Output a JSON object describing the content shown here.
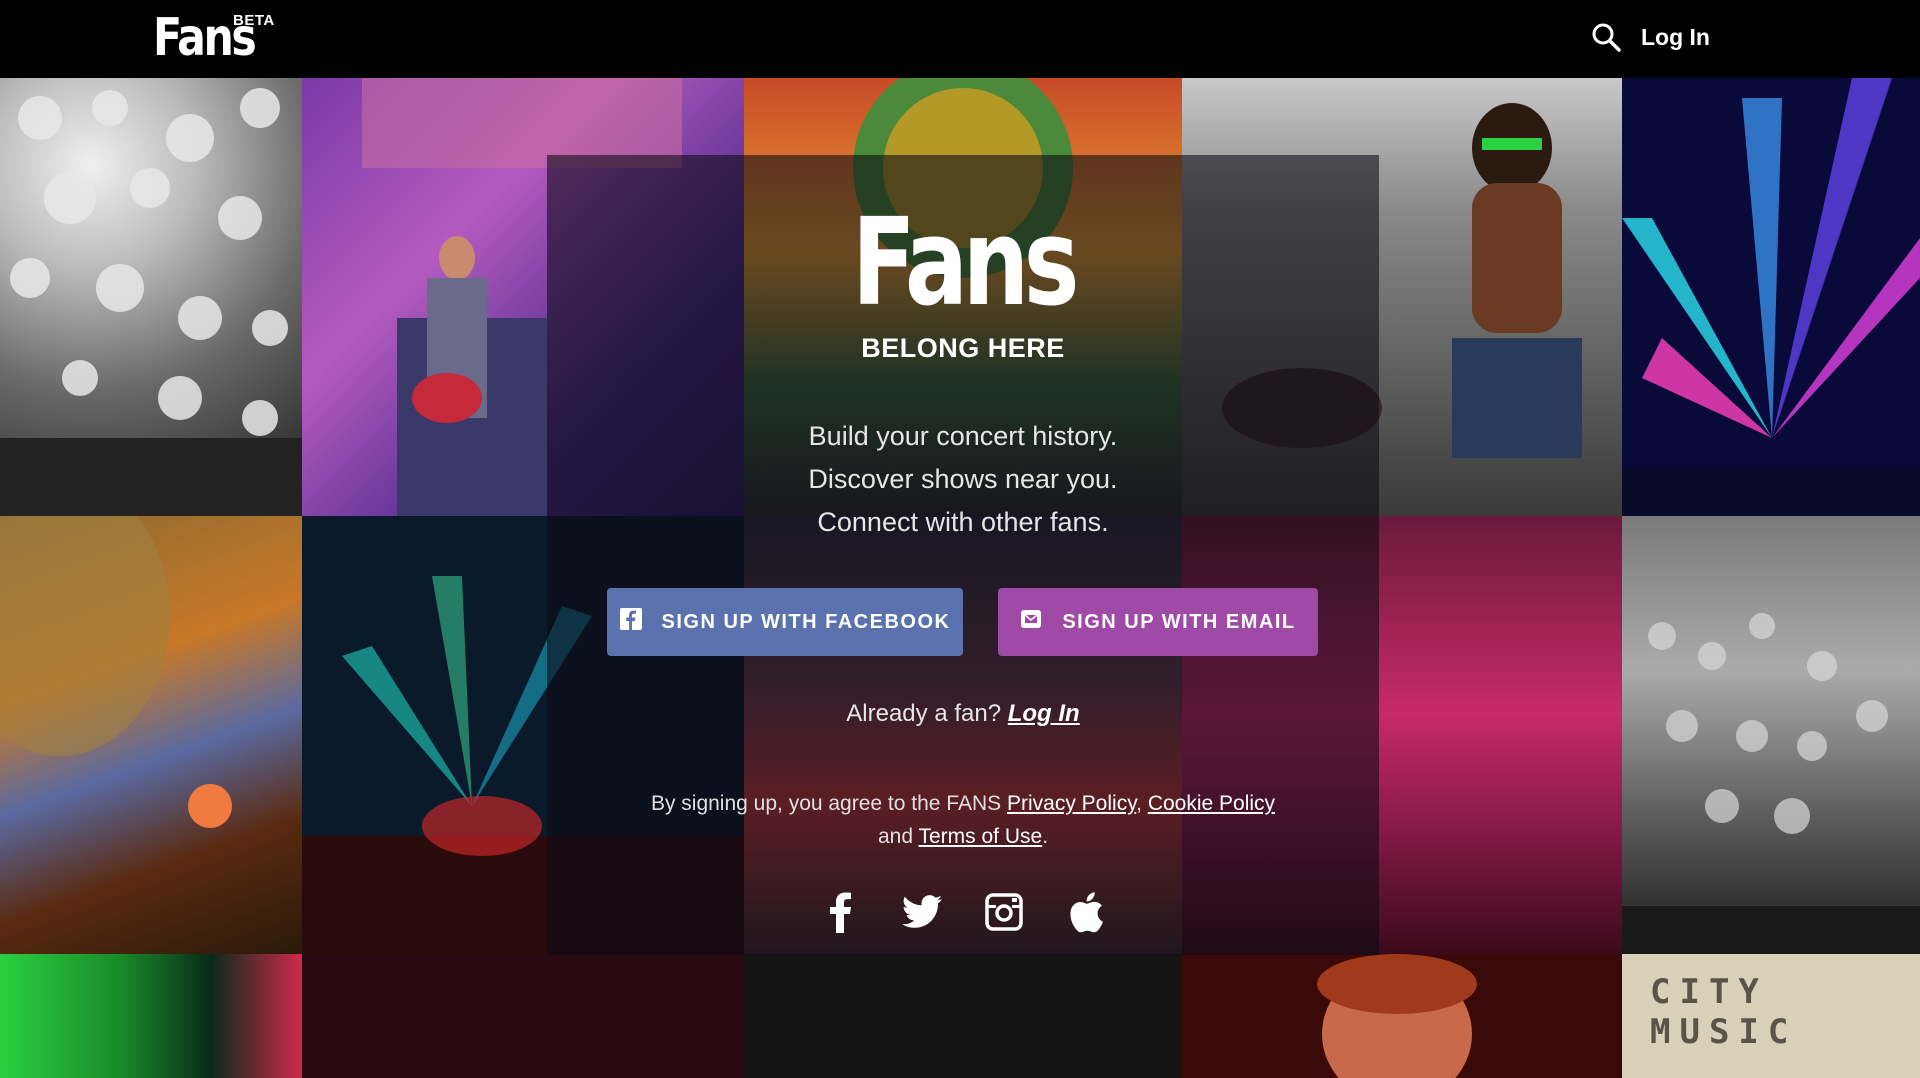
{
  "header": {
    "logo": "Fans",
    "beta": "BETA",
    "search_icon": "search-icon",
    "login": "Log In"
  },
  "hero": {
    "logo": "Fans",
    "tagline": "BELONG HERE",
    "pitch": [
      "Build your concert history.",
      "Discover shows near you.",
      "Connect with other fans."
    ],
    "facebook_button": "SIGN UP WITH FACEBOOK",
    "email_button": "SIGN UP WITH EMAIL",
    "already_text": "Already a fan?",
    "already_link": "Log In",
    "legal": {
      "prefix": "By signing up, you agree to the FANS",
      "privacy": "Privacy Policy",
      "cookie": "Cookie Policy",
      "and": "and",
      "terms": "Terms of Use"
    }
  },
  "background_text": "CITY MUSIC",
  "socials": [
    "facebook-icon",
    "twitter-icon",
    "instagram-icon",
    "apple-icon"
  ],
  "colors": {
    "facebook_button": "#5a72ad",
    "email_button": "#a04aa8",
    "topbar": "#000000"
  }
}
